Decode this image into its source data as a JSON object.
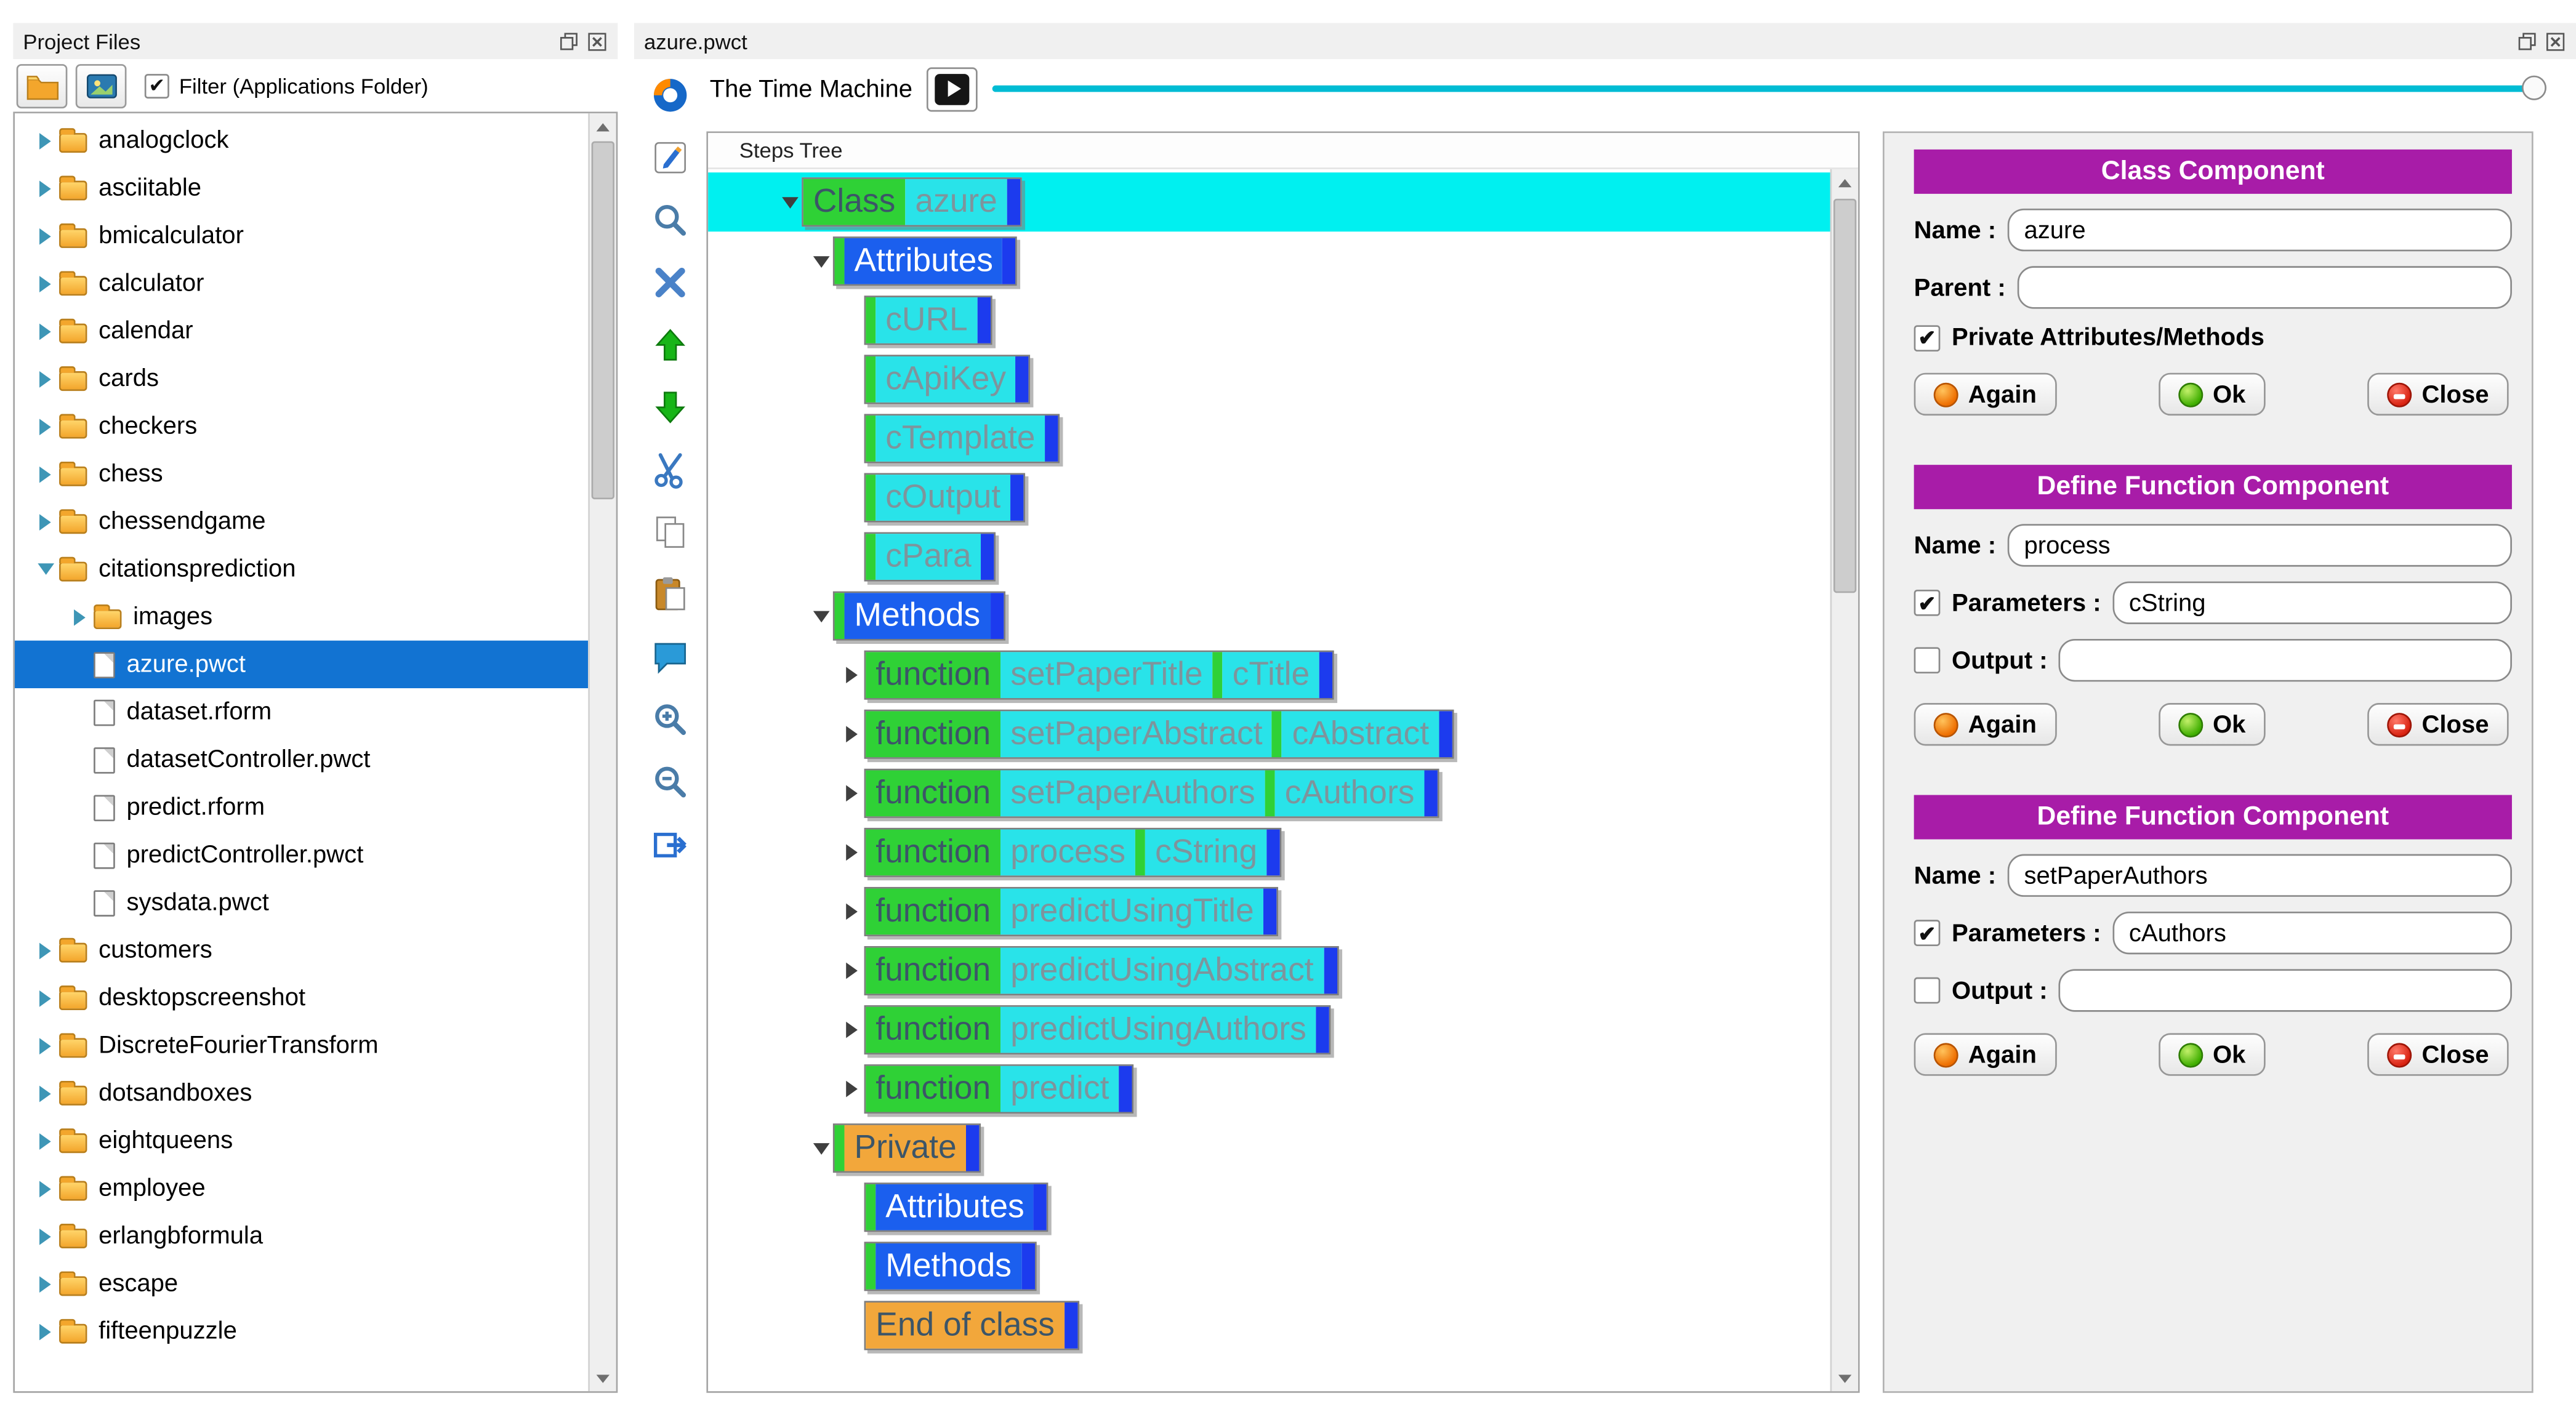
{
  "left_panel": {
    "title": "Project Files",
    "filter_label": "Filter (Applications Folder)",
    "filter_checked": true,
    "toolbar_buttons": [
      "open-folder",
      "pictures"
    ],
    "tree": [
      {
        "label": "analogclock",
        "icon": "folder",
        "arrow": "collapsed",
        "indent": 0
      },
      {
        "label": "asciitable",
        "icon": "folder",
        "arrow": "collapsed",
        "indent": 0
      },
      {
        "label": "bmicalculator",
        "icon": "folder",
        "arrow": "collapsed",
        "indent": 0
      },
      {
        "label": "calculator",
        "icon": "folder",
        "arrow": "collapsed",
        "indent": 0
      },
      {
        "label": "calendar",
        "icon": "folder",
        "arrow": "collapsed",
        "indent": 0
      },
      {
        "label": "cards",
        "icon": "folder",
        "arrow": "collapsed",
        "indent": 0
      },
      {
        "label": "checkers",
        "icon": "folder",
        "arrow": "collapsed",
        "indent": 0
      },
      {
        "label": "chess",
        "icon": "folder",
        "arrow": "collapsed",
        "indent": 0
      },
      {
        "label": "chessendgame",
        "icon": "folder",
        "arrow": "collapsed",
        "indent": 0
      },
      {
        "label": "citationsprediction",
        "icon": "folder",
        "arrow": "expanded",
        "indent": 0
      },
      {
        "label": "images",
        "icon": "folder",
        "arrow": "collapsed",
        "indent": 1
      },
      {
        "label": "azure.pwct",
        "icon": "file",
        "indent": 1,
        "selected": true
      },
      {
        "label": "dataset.rform",
        "icon": "file",
        "indent": 1
      },
      {
        "label": "datasetController.pwct",
        "icon": "file",
        "indent": 1
      },
      {
        "label": "predict.rform",
        "icon": "file",
        "indent": 1
      },
      {
        "label": "predictController.pwct",
        "icon": "file",
        "indent": 1
      },
      {
        "label": "sysdata.pwct",
        "icon": "file",
        "indent": 1
      },
      {
        "label": "customers",
        "icon": "folder",
        "arrow": "collapsed",
        "indent": 0
      },
      {
        "label": "desktopscreenshot",
        "icon": "folder",
        "arrow": "collapsed",
        "indent": 0
      },
      {
        "label": "DiscreteFourierTransform",
        "icon": "folder",
        "arrow": "collapsed",
        "indent": 0
      },
      {
        "label": "dotsandboxes",
        "icon": "folder",
        "arrow": "collapsed",
        "indent": 0
      },
      {
        "label": "eightqueens",
        "icon": "folder",
        "arrow": "collapsed",
        "indent": 0
      },
      {
        "label": "employee",
        "icon": "folder",
        "arrow": "collapsed",
        "indent": 0
      },
      {
        "label": "erlangbformula",
        "icon": "folder",
        "arrow": "collapsed",
        "indent": 0
      },
      {
        "label": "escape",
        "icon": "folder",
        "arrow": "collapsed",
        "indent": 0
      },
      {
        "label": "fifteenpuzzle",
        "icon": "folder",
        "arrow": "collapsed",
        "indent": 0
      }
    ]
  },
  "editor": {
    "title": "azure.pwct",
    "time_machine_label": "The Time Machine",
    "toolbar_icons": [
      "navigate",
      "edit",
      "find",
      "delete",
      "move-up",
      "move-down",
      "cut",
      "copy",
      "paste",
      "comment",
      "zoom-in",
      "zoom-out",
      "run"
    ],
    "steps_tree": {
      "header": "Steps Tree",
      "rows": [
        {
          "indent": 0,
          "arrow": "down",
          "selected": true,
          "segments": [
            {
              "t": "Class",
              "s": "kw"
            },
            {
              "t": "azure",
              "s": "val"
            }
          ]
        },
        {
          "indent": 1,
          "arrow": "down",
          "segments": [
            {
              "t": "Attributes",
              "s": "blk"
            }
          ]
        },
        {
          "indent": 2,
          "segments": [
            {
              "t": "cURL",
              "s": "val"
            }
          ]
        },
        {
          "indent": 2,
          "segments": [
            {
              "t": "cApiKey",
              "s": "val"
            }
          ]
        },
        {
          "indent": 2,
          "segments": [
            {
              "t": "cTemplate",
              "s": "val"
            }
          ]
        },
        {
          "indent": 2,
          "segments": [
            {
              "t": "cOutput",
              "s": "val"
            }
          ]
        },
        {
          "indent": 2,
          "segments": [
            {
              "t": "cPara",
              "s": "val"
            }
          ]
        },
        {
          "indent": 1,
          "arrow": "down",
          "segments": [
            {
              "t": "Methods",
              "s": "blk"
            }
          ]
        },
        {
          "indent": 2,
          "arrow": "right",
          "segments": [
            {
              "t": "function",
              "s": "kw"
            },
            {
              "t": "setPaperTitle",
              "s": "val"
            },
            {
              "t": "cTitle",
              "s": "val"
            }
          ]
        },
        {
          "indent": 2,
          "arrow": "right",
          "segments": [
            {
              "t": "function",
              "s": "kw"
            },
            {
              "t": "setPaperAbstract",
              "s": "val"
            },
            {
              "t": "cAbstract",
              "s": "val"
            }
          ]
        },
        {
          "indent": 2,
          "arrow": "right",
          "segments": [
            {
              "t": "function",
              "s": "kw"
            },
            {
              "t": "setPaperAuthors",
              "s": "val"
            },
            {
              "t": "cAuthors",
              "s": "val"
            }
          ]
        },
        {
          "indent": 2,
          "arrow": "right",
          "segments": [
            {
              "t": "function",
              "s": "kw"
            },
            {
              "t": "process",
              "s": "val"
            },
            {
              "t": "cString",
              "s": "val"
            }
          ]
        },
        {
          "indent": 2,
          "arrow": "right",
          "segments": [
            {
              "t": "function",
              "s": "kw"
            },
            {
              "t": "predictUsingTitle",
              "s": "val"
            }
          ]
        },
        {
          "indent": 2,
          "arrow": "right",
          "segments": [
            {
              "t": "function",
              "s": "kw"
            },
            {
              "t": "predictUsingAbstract",
              "s": "val"
            }
          ]
        },
        {
          "indent": 2,
          "arrow": "right",
          "segments": [
            {
              "t": "function",
              "s": "kw"
            },
            {
              "t": "predictUsingAuthors",
              "s": "val"
            }
          ]
        },
        {
          "indent": 2,
          "arrow": "right",
          "segments": [
            {
              "t": "function",
              "s": "kw"
            },
            {
              "t": "predict",
              "s": "val"
            }
          ]
        },
        {
          "indent": 1,
          "arrow": "down",
          "segments": [
            {
              "t": "Private",
              "s": "mark"
            }
          ]
        },
        {
          "indent": 2,
          "segments": [
            {
              "t": "Attributes",
              "s": "blk"
            }
          ]
        },
        {
          "indent": 2,
          "segments": [
            {
              "t": "Methods",
              "s": "blk"
            }
          ]
        },
        {
          "indent": 2,
          "lead": false,
          "segments": [
            {
              "t": "End of class",
              "s": "mark"
            }
          ]
        }
      ]
    }
  },
  "right_panel": {
    "accent_color": "#a81ca8",
    "forms": [
      {
        "title": "Class Component",
        "rows": [
          {
            "type": "field",
            "label": "Name :",
            "value": "azure"
          },
          {
            "type": "field",
            "label": "Parent :",
            "value": ""
          },
          {
            "type": "check",
            "label": "Private Attributes/Methods",
            "checked": true
          }
        ],
        "buttons": [
          {
            "label": "Again",
            "icon": "again"
          },
          {
            "label": "Ok",
            "icon": "ok"
          },
          {
            "label": "Close",
            "icon": "close"
          }
        ]
      },
      {
        "title": "Define Function Component",
        "rows": [
          {
            "type": "field",
            "label": "Name :",
            "value": "process"
          },
          {
            "type": "checkfield",
            "label": "Parameters :",
            "checked": true,
            "value": "cString"
          },
          {
            "type": "checkfield",
            "label": "Output :",
            "checked": false,
            "value": ""
          }
        ],
        "buttons": [
          {
            "label": "Again",
            "icon": "again"
          },
          {
            "label": "Ok",
            "icon": "ok"
          },
          {
            "label": "Close",
            "icon": "close"
          }
        ]
      },
      {
        "title": "Define Function Component",
        "rows": [
          {
            "type": "field",
            "label": "Name :",
            "value": "setPaperAuthors"
          },
          {
            "type": "checkfield",
            "label": "Parameters :",
            "checked": true,
            "value": "cAuthors"
          },
          {
            "type": "checkfield",
            "label": "Output :",
            "checked": false,
            "value": ""
          }
        ],
        "buttons": [
          {
            "label": "Again",
            "icon": "again"
          },
          {
            "label": "Ok",
            "icon": "ok"
          },
          {
            "label": "Close",
            "icon": "close"
          }
        ]
      }
    ]
  }
}
